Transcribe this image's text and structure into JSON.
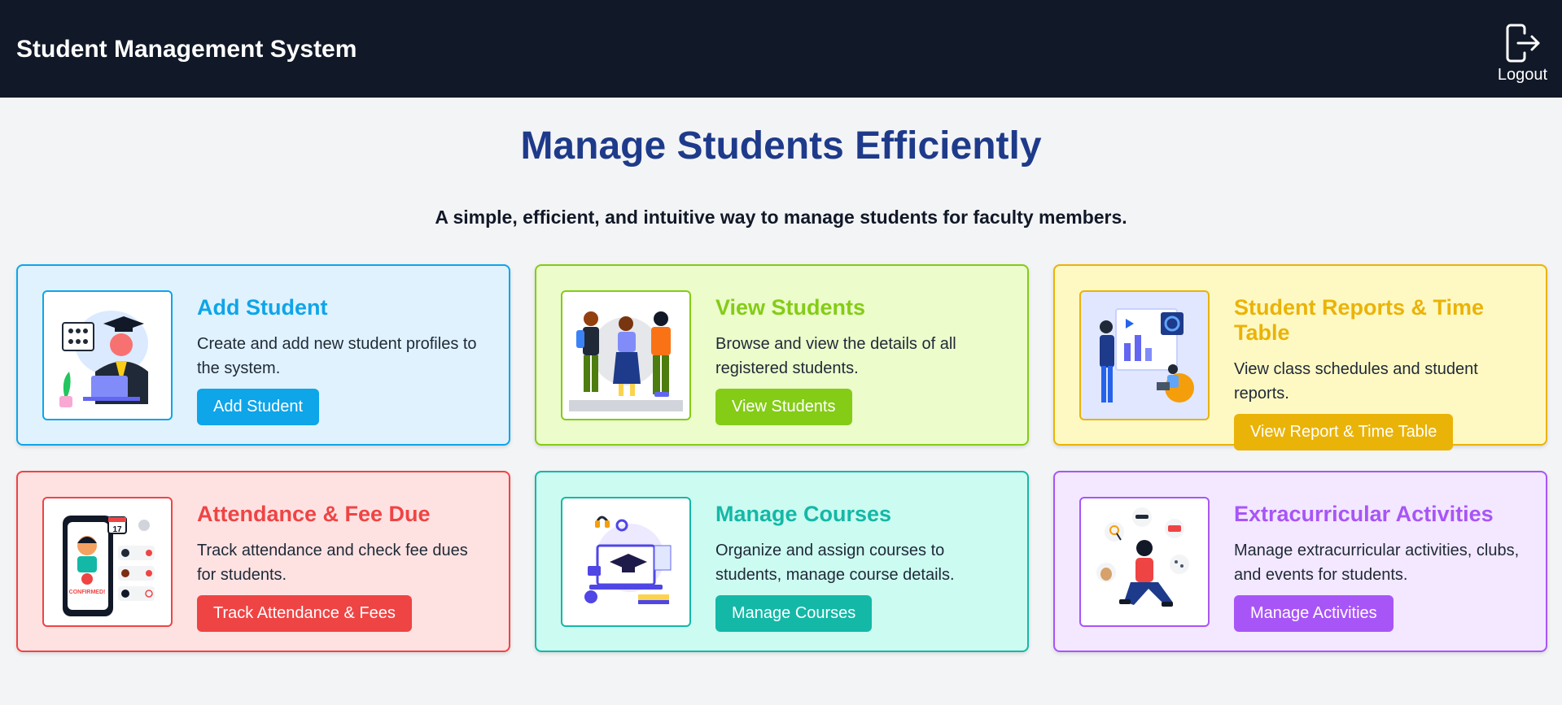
{
  "app": {
    "title": "Student Management System",
    "logout_label": "Logout"
  },
  "hero": {
    "title": "Manage Students Efficiently",
    "subtitle": "A simple, efficient, and intuitive way to manage students for faculty members."
  },
  "cards": [
    {
      "title": "Add Student",
      "description": "Create and add new student profiles to the system.",
      "button": "Add Student",
      "accent": "#0ea5e9",
      "bg": "#e0f2fe",
      "icon": "graduate-illustration"
    },
    {
      "title": "View Students",
      "description": "Browse and view the details of all registered students.",
      "button": "View Students",
      "accent": "#84cc16",
      "bg": "#ecfccb",
      "icon": "students-group-illustration"
    },
    {
      "title": "Student Reports & Time Table",
      "description": "View class schedules and student reports.",
      "button": "View Report & Time Table",
      "accent": "#eab308",
      "bg": "#fef9c3",
      "icon": "report-illustration"
    },
    {
      "title": "Attendance & Fee Due",
      "description": "Track attendance and check fee dues for students.",
      "button": "Track Attendance & Fees",
      "accent": "#ef4444",
      "bg": "#fee2e2",
      "icon": "attendance-phone-illustration",
      "thumb_text": [
        "17",
        "CONFIRMED!"
      ]
    },
    {
      "title": "Manage Courses",
      "description": "Organize and assign courses to students, manage course details.",
      "button": "Manage Courses",
      "accent": "#14b8a6",
      "bg": "#ccfbf1",
      "icon": "online-course-illustration"
    },
    {
      "title": "Extracurricular Activities",
      "description": "Manage extracurricular activities, clubs, and events for students.",
      "button": "Manage Activities",
      "accent": "#a855f7",
      "bg": "#f3e8ff",
      "icon": "activities-illustration"
    }
  ]
}
